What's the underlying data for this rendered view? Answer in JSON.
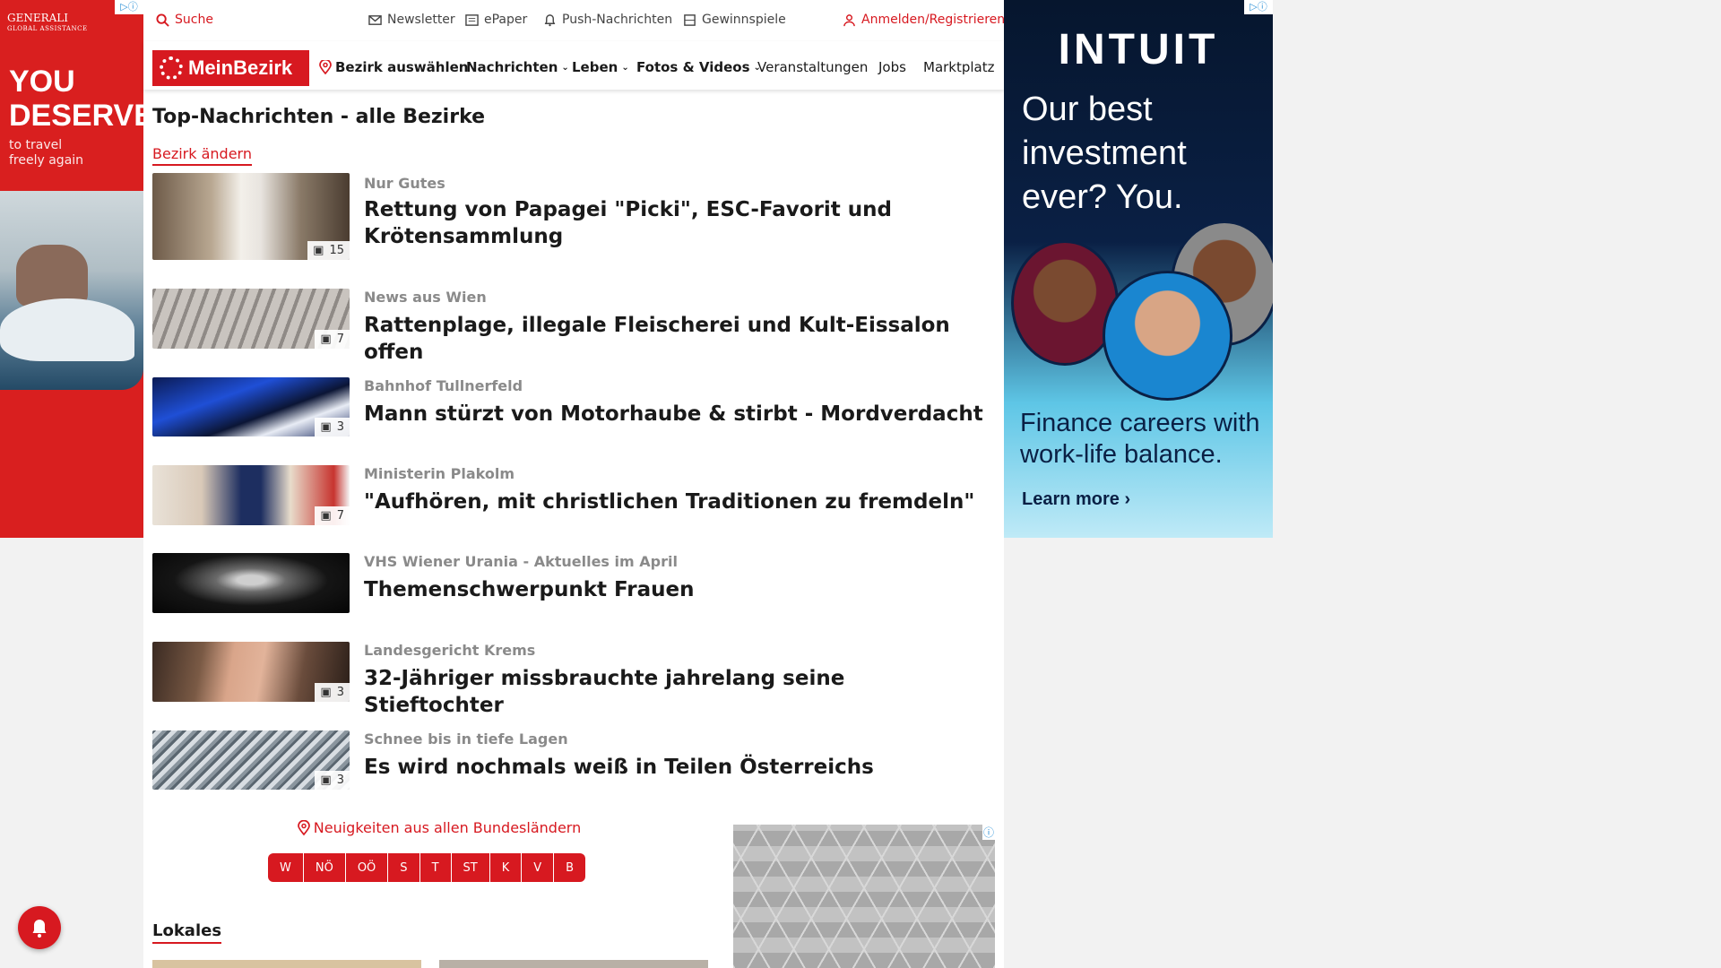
{
  "ads": {
    "left": {
      "brand": "GENERALI",
      "brand_sub": "GLOBAL ASSISTANCE",
      "headline_1": "YOU",
      "headline_2": "DESERVE",
      "sub_1": "to travel",
      "sub_2": "freely again"
    },
    "right": {
      "brand": "INTUIT",
      "tagline_1": "Our best",
      "tagline_2": "investment",
      "tagline_3": "ever? You.",
      "finance_1": "Finance careers with",
      "finance_2": "work-life balance.",
      "cta": "Learn more ›"
    },
    "adchoices_icon": "ⓘ"
  },
  "topbar": {
    "search": "Suche",
    "newsletter": "Newsletter",
    "epaper": "ePaper",
    "push": "Push-Nachrichten",
    "games": "Gewinnspiele",
    "login": "Anmelden/Registrieren"
  },
  "nav": {
    "logo": "MeinBezirk",
    "district": "Bezirk auswählen",
    "items": [
      "Nachrichten",
      "Leben",
      "Fotos & Videos",
      "Veranstaltungen",
      "Jobs",
      "Marktplatz"
    ]
  },
  "page": {
    "title": "Top-Nachrichten - alle Bezirke",
    "change_district": "Bezirk ändern"
  },
  "articles": [
    {
      "kicker": "Nur Gutes",
      "headline": "Rettung von Papagei \"Picki\", ESC-Favorit und Krötensammlung",
      "photos": "15"
    },
    {
      "kicker": "News aus Wien",
      "headline": "Rattenplage, illegale Fleischerei und Kult-Eissalon offen",
      "photos": "7"
    },
    {
      "kicker": "Bahnhof Tullnerfeld",
      "headline": "Mann stürzt von Motorhaube & stirbt - Mordverdacht",
      "photos": "3"
    },
    {
      "kicker": "Ministerin Plakolm",
      "headline": "\"Aufhören, mit christlichen Traditionen zu fremdeln\"",
      "photos": "7"
    },
    {
      "kicker": "VHS Wiener Urania - Aktuelles im April",
      "headline": "Themenschwerpunkt Frauen",
      "photos": ""
    },
    {
      "kicker": "Landesgericht Krems",
      "headline": "32-Jähriger missbrauchte jahrelang seine Stieftochter",
      "photos": "3"
    },
    {
      "kicker": "Schnee bis in tiefe Lagen",
      "headline": "Es wird nochmals weiß in Teilen Österreichs",
      "photos": "3"
    }
  ],
  "states": {
    "label": "Neuigkeiten aus allen Bundesländern",
    "items": [
      "W",
      "NÖ",
      "OÖ",
      "S",
      "T",
      "ST",
      "K",
      "V",
      "B"
    ]
  },
  "lokales": "Lokales",
  "colors": {
    "brand_red": "#d71920"
  }
}
